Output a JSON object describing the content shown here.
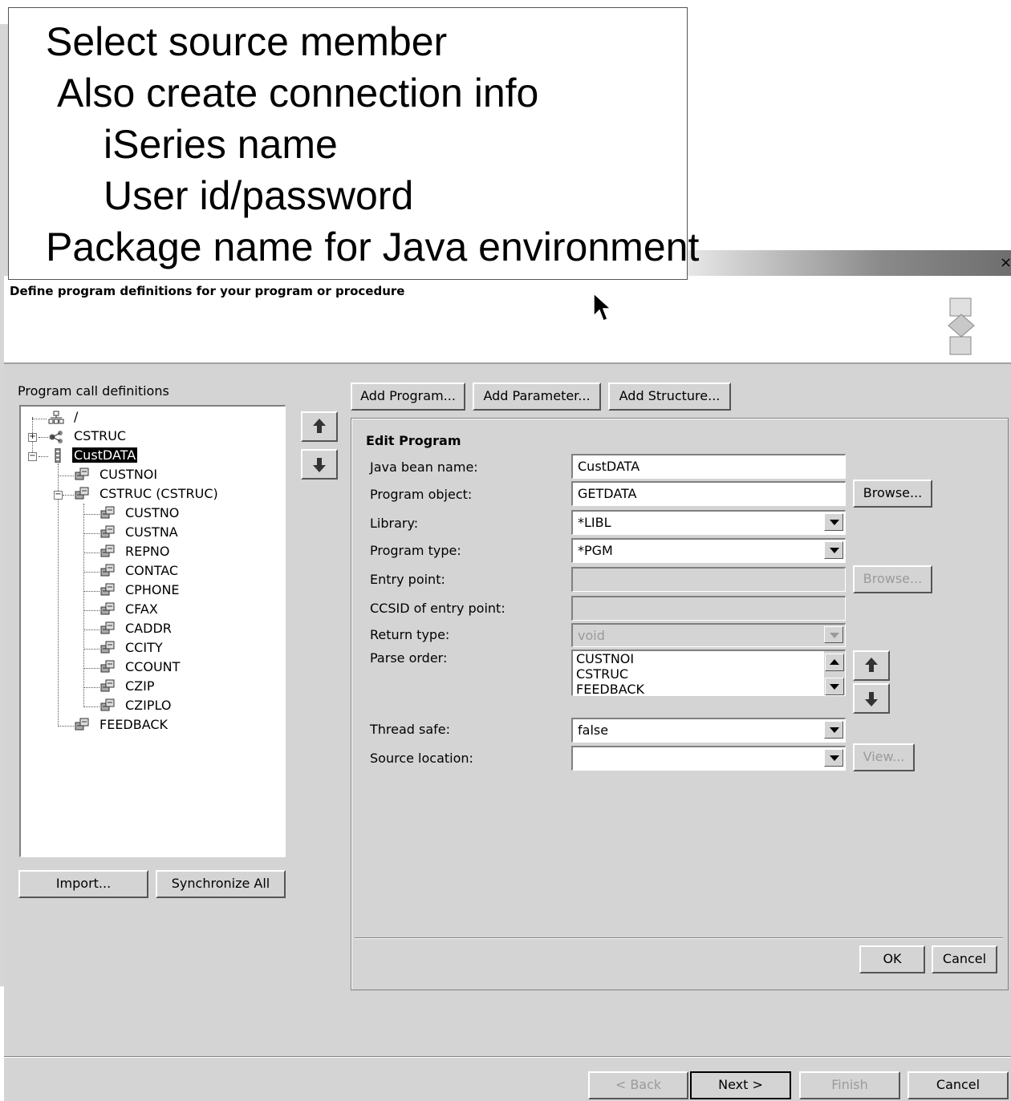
{
  "callout": {
    "lines": [
      "Select source member",
      "Also create connection info",
      "iSeries name",
      "User id/password",
      "Package name for Java environment"
    ]
  },
  "dialog": {
    "close_glyph": "×",
    "header_title": "Define program definitions for your program or procedure"
  },
  "left": {
    "tree_label": "Program call definitions",
    "tree": {
      "root": "/",
      "cstruc": "CSTRUC",
      "custdata": "CustDATA",
      "custnoi": "CUSTNOI",
      "cstruc_child": "CSTRUC (CSTRUC)",
      "fields": [
        "CUSTNO",
        "CUSTNA",
        "REPNO",
        "CONTAC",
        "CPHONE",
        "CFAX",
        "CADDR",
        "CCITY",
        "CCOUNT",
        "CZIP",
        "CZIPLO"
      ],
      "feedback": "FEEDBACK"
    },
    "import_label": "Import...",
    "sync_label": "Synchronize All"
  },
  "toolbar": {
    "add_program": "Add Program...",
    "add_parameter": "Add Parameter...",
    "add_structure": "Add Structure..."
  },
  "edit": {
    "section_title": "Edit Program",
    "java_bean_label": "Java bean name:",
    "java_bean_value": "CustDATA",
    "program_object_label": "Program object:",
    "program_object_value": "GETDATA",
    "browse_label": "Browse...",
    "library_label": "Library:",
    "library_value": "*LIBL",
    "program_type_label": "Program type:",
    "program_type_value": "*PGM",
    "entry_point_label": "Entry point:",
    "entry_point_value": "",
    "browse2_label": "Browse...",
    "ccsid_label": "CCSID of entry point:",
    "ccsid_value": "",
    "return_type_label": "Return type:",
    "return_type_value": "void",
    "parse_order_label": "Parse order:",
    "parse_order_items": [
      "CUSTNOI",
      "CSTRUC",
      "FEEDBACK"
    ],
    "thread_safe_label": "Thread safe:",
    "thread_safe_value": "false",
    "source_location_label": "Source location:",
    "source_location_value": "",
    "view_label": "View...",
    "ok_label": "OK",
    "cancel_label": "Cancel"
  },
  "footer": {
    "back_label": "< Back",
    "next_label": "Next >",
    "finish_label": "Finish",
    "cancel_label": "Cancel"
  }
}
